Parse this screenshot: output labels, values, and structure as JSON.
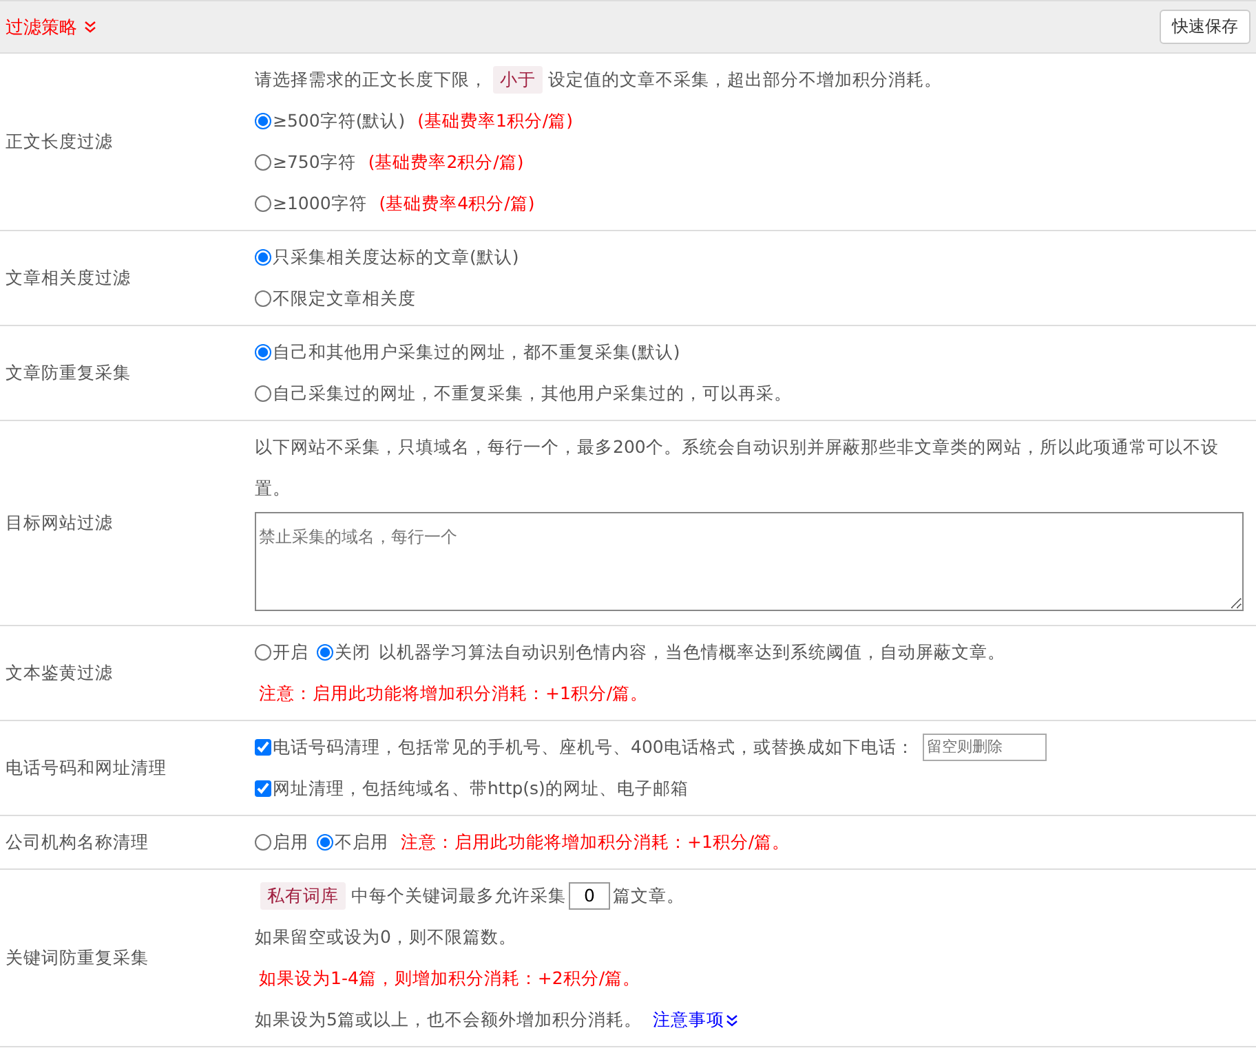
{
  "header": {
    "title": "过滤策略",
    "save_button": "快速保存"
  },
  "rows": [
    {
      "label": "正文长度过滤",
      "lines": [
        {
          "parts": [
            {
              "kind": "text",
              "text": "请选择需求的正文长度下限，"
            },
            {
              "kind": "tag",
              "text": "小于"
            },
            {
              "kind": "text",
              "text": "设定值的文章不采集，超出部分不增加积分消耗。"
            }
          ]
        },
        {
          "parts": [
            {
              "kind": "radio",
              "text": "≥500字符(默认)",
              "selected": true
            },
            {
              "kind": "note",
              "text": "(基础费率1积分/篇)"
            }
          ]
        },
        {
          "parts": [
            {
              "kind": "radio",
              "text": "≥750字符",
              "selected": false
            },
            {
              "kind": "note",
              "text": "(基础费率2积分/篇)"
            }
          ]
        },
        {
          "parts": [
            {
              "kind": "radio",
              "text": "≥1000字符",
              "selected": false
            },
            {
              "kind": "note",
              "text": "(基础费率4积分/篇)"
            }
          ]
        }
      ]
    },
    {
      "label": "文章相关度过滤",
      "lines": [
        {
          "parts": [
            {
              "kind": "radio",
              "text": "只采集相关度达标的文章(默认)",
              "selected": true
            }
          ]
        },
        {
          "parts": [
            {
              "kind": "radio",
              "text": "不限定文章相关度",
              "selected": false
            }
          ]
        }
      ]
    },
    {
      "label": "文章防重复采集",
      "lines": [
        {
          "parts": [
            {
              "kind": "radio",
              "text": "自己和其他用户采集过的网址，都不重复采集(默认)",
              "selected": true
            }
          ]
        },
        {
          "parts": [
            {
              "kind": "radio",
              "text": "自己采集过的网址，不重复采集，其他用户采集过的，可以再采。",
              "selected": false
            }
          ]
        }
      ]
    },
    {
      "label": "目标网站过滤",
      "lines": [
        {
          "parts": [
            {
              "kind": "text",
              "text": "以下网站不采集，只填域名，每行一个，最多200个。系统会自动识别并屏蔽那些非文章类的网站，所以此项通常可以不设置。"
            }
          ]
        },
        {
          "parts": [
            {
              "kind": "textarea",
              "placeholder": "禁止采集的域名，每行一个"
            }
          ]
        }
      ]
    },
    {
      "label": "文本鉴黄过滤",
      "lines": [
        {
          "parts": [
            {
              "kind": "radio",
              "text": "开启",
              "selected": false
            },
            {
              "kind": "radio",
              "text": "关闭",
              "selected": true
            },
            {
              "kind": "text",
              "text": "以机器学习算法自动识别色情内容，当色情概率达到系统阈值，自动屏蔽文章。"
            }
          ]
        },
        {
          "parts": [
            {
              "kind": "note",
              "text": "注意：启用此功能将增加积分消耗：+1积分/篇。"
            }
          ]
        }
      ]
    },
    {
      "label": "电话号码和网址清理",
      "lines": [
        {
          "parts": [
            {
              "kind": "checkbox",
              "text": "电话号码清理，包括常见的手机号、座机号、400电话格式，或替换成如下电话：",
              "checked": true
            },
            {
              "kind": "input",
              "placeholder": "留空则删除"
            }
          ]
        },
        {
          "parts": [
            {
              "kind": "checkbox",
              "text": "网址清理，包括纯域名、带http(s)的网址、电子邮箱",
              "checked": true
            }
          ]
        }
      ]
    },
    {
      "label": "公司机构名称清理",
      "lines": [
        {
          "parts": [
            {
              "kind": "radio",
              "text": "启用",
              "selected": false
            },
            {
              "kind": "radio",
              "text": "不启用",
              "selected": true
            },
            {
              "kind": "note",
              "text": "注意：启用此功能将增加积分消耗：+1积分/篇。"
            }
          ]
        }
      ]
    },
    {
      "label": "关键词防重复采集",
      "lines": [
        {
          "parts": [
            {
              "kind": "tag",
              "text": "私有词库"
            },
            {
              "kind": "text",
              "text": "中每个关键词最多允许采集"
            },
            {
              "kind": "number",
              "value": "0"
            },
            {
              "kind": "text",
              "text": "篇文章。"
            }
          ]
        },
        {
          "parts": [
            {
              "kind": "text",
              "text": "如果留空或设为0，则不限篇数。"
            }
          ]
        },
        {
          "parts": [
            {
              "kind": "note",
              "text": "如果设为1-4篇，则增加积分消耗：+2积分/篇。"
            }
          ]
        },
        {
          "parts": [
            {
              "kind": "text",
              "text": "如果设为5篇或以上，也不会额外增加积分消耗。"
            },
            {
              "kind": "link",
              "text": "注意事项"
            }
          ]
        }
      ]
    }
  ]
}
